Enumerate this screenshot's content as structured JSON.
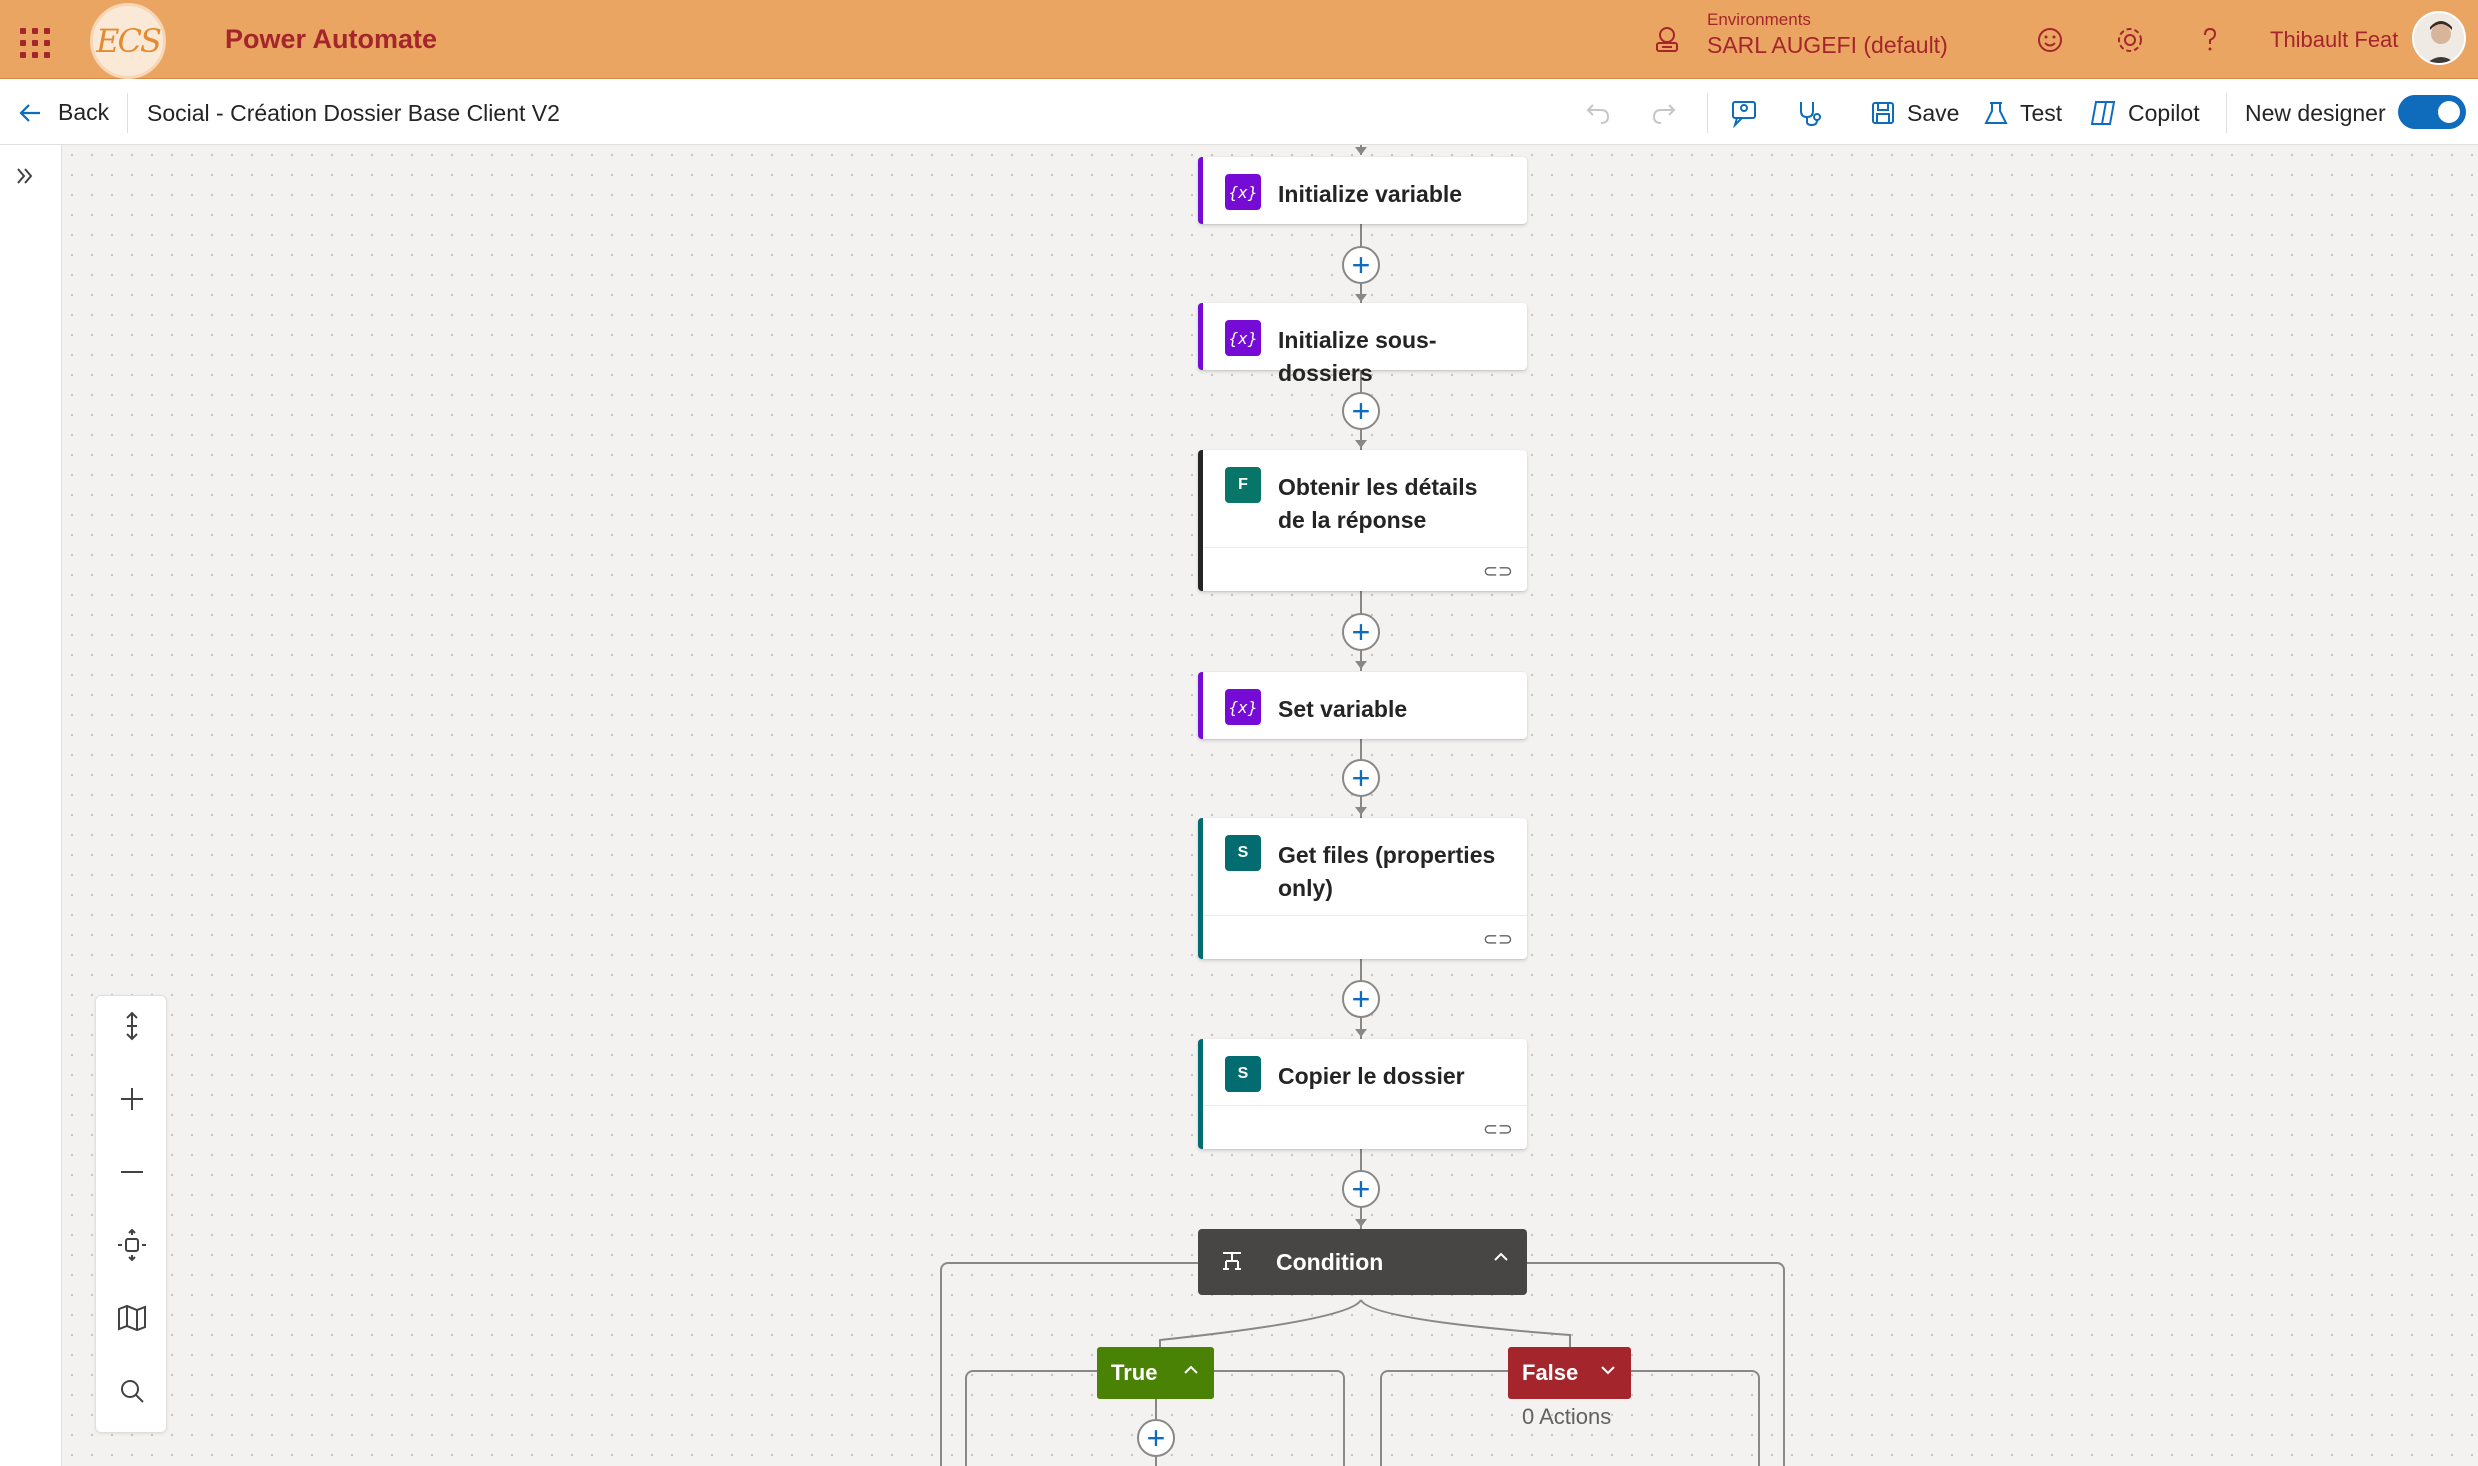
{
  "header": {
    "app_title": "Power Automate",
    "logo_text": "ECS",
    "environment_label": "Environments",
    "environment_name": "SARL AUGEFI (default)",
    "user_name": "Thibault Feat"
  },
  "command_bar": {
    "back_label": "Back",
    "flow_name": "Social - Création Dossier Base Client V2",
    "save_label": "Save",
    "test_label": "Test",
    "copilot_label": "Copilot",
    "new_designer_label": "New designer",
    "new_designer_enabled": true
  },
  "flow": {
    "cards": [
      {
        "title": "Initialize variable",
        "icon": "variable-icon",
        "type": "variable"
      },
      {
        "title": "Initialize sous-dossiers",
        "icon": "variable-icon",
        "type": "variable"
      },
      {
        "title": "Obtenir les détails de la réponse",
        "icon": "forms-icon",
        "type": "forms",
        "has_link": true
      },
      {
        "title": "Set variable",
        "icon": "variable-icon",
        "type": "variable"
      },
      {
        "title": "Get files (properties only)",
        "icon": "sharepoint-icon",
        "type": "sharepoint",
        "has_link": true
      },
      {
        "title": "Copier le dossier",
        "icon": "sharepoint-icon",
        "type": "sharepoint",
        "has_link": true
      }
    ],
    "condition": {
      "title": "Condition",
      "true_label": "True",
      "false_label": "False",
      "false_actions": "0 Actions"
    }
  },
  "colors": {
    "header_bg": "#eba563",
    "header_text": "#a4262c",
    "variable_accent": "#770bd6",
    "sharepoint_accent": "#036c70",
    "true_branch": "#498205",
    "false_branch": "#a4262c",
    "condition_bg": "#484644",
    "toggle_on": "#0f6cbd"
  }
}
